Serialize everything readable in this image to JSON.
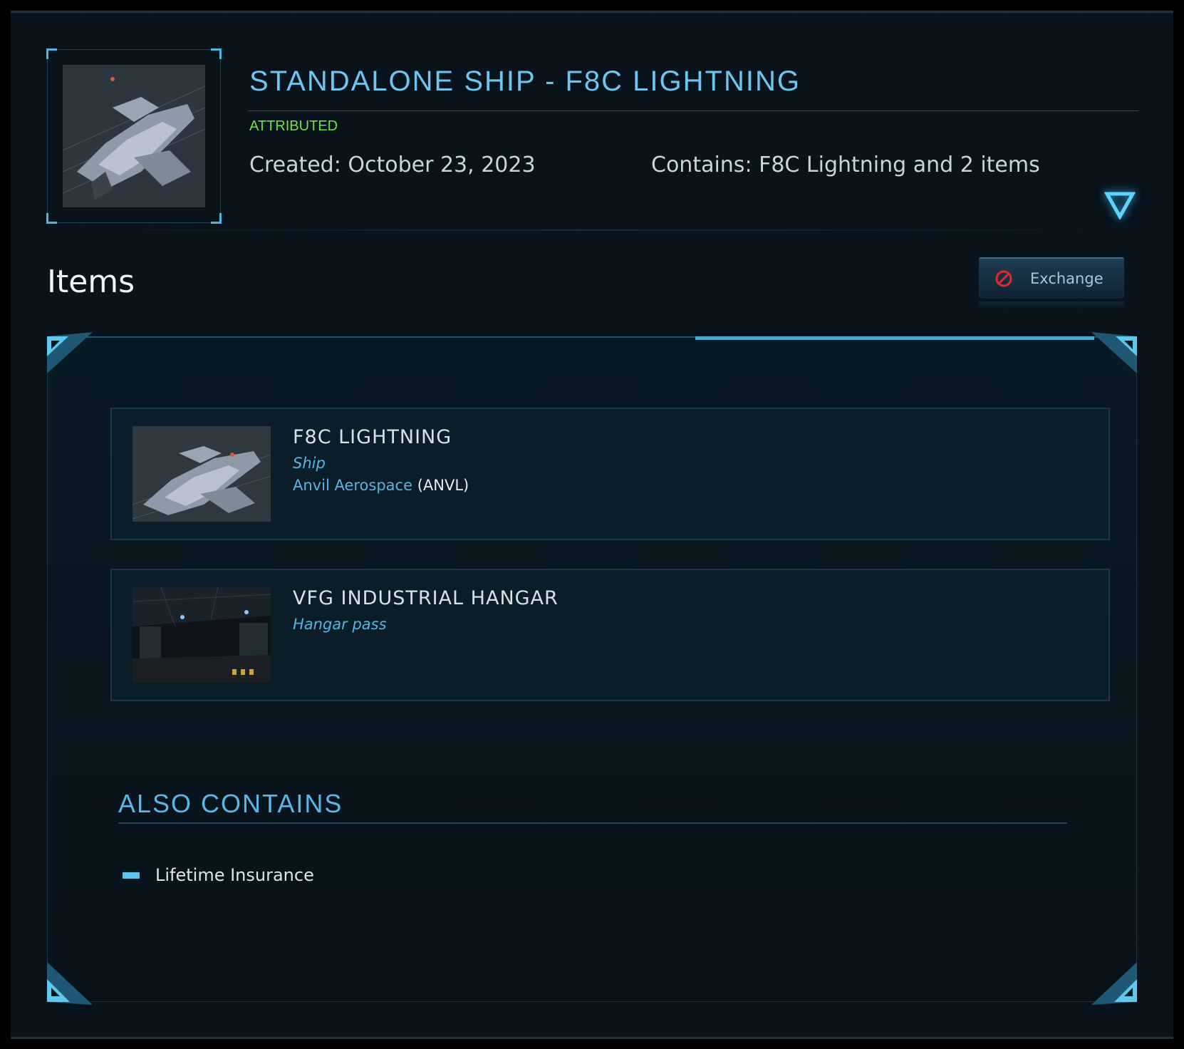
{
  "pledge": {
    "title": "STANDALONE SHIP - F8C LIGHTNING",
    "status": "ATTRIBUTED",
    "created": "Created: October 23, 2023",
    "contains": "Contains: F8C Lightning and 2 items",
    "thumbnail_icon": "ship-thumbnail"
  },
  "items_section": {
    "heading": "Items",
    "exchange_label": "Exchange",
    "exchange_icon": "ban-icon"
  },
  "items": [
    {
      "name": "F8C LIGHTNING",
      "kind": "Ship",
      "manufacturer": "Anvil Aerospace",
      "manufacturer_code": "(ANVL)"
    },
    {
      "name": "VFG INDUSTRIAL HANGAR",
      "kind": "Hangar pass"
    }
  ],
  "also_contains": {
    "title": "ALSO CONTAINS",
    "items": [
      "Lifetime Insurance"
    ]
  },
  "colors": {
    "accent": "#6cc6ee",
    "status_green": "#6ee04a",
    "ban_red": "#e02a2a"
  }
}
